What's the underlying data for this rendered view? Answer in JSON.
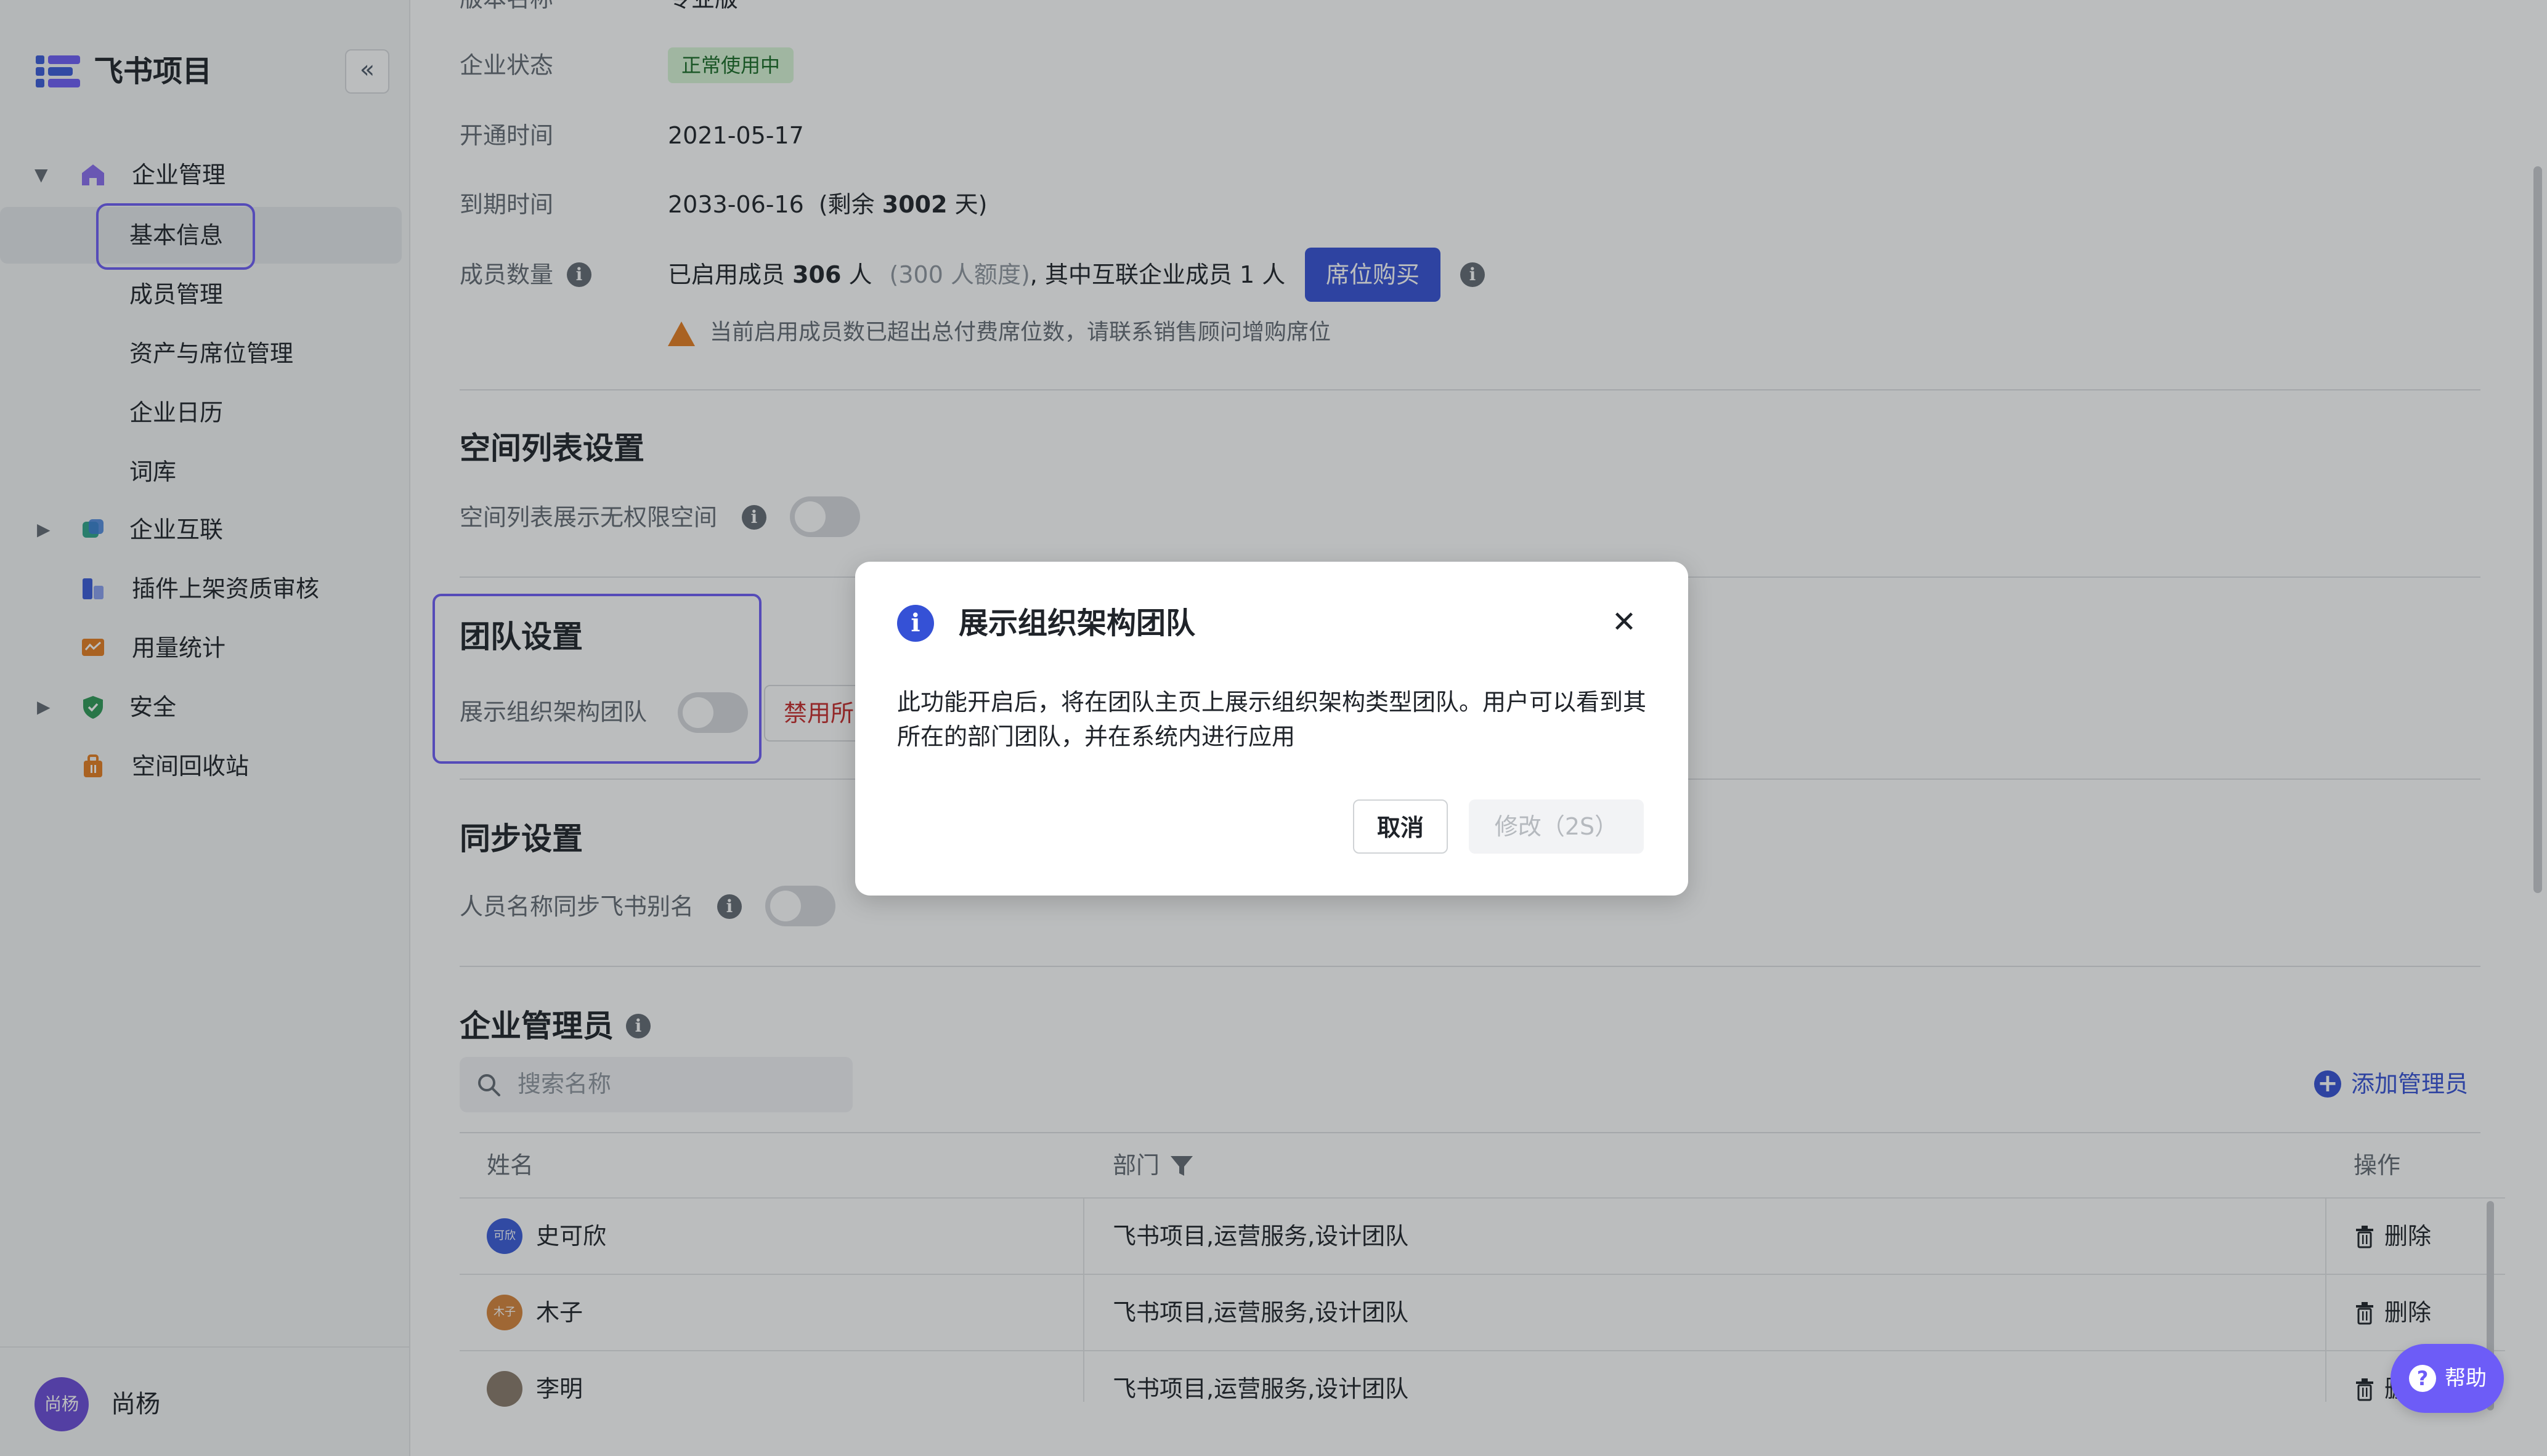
{
  "app": {
    "title": "飞书项目",
    "collapse_icon": "«"
  },
  "sidebar": {
    "items": [
      {
        "label": "企业管理",
        "icon": "home-icon",
        "expanded": true
      },
      {
        "label": "基本信息",
        "active": true
      },
      {
        "label": "成员管理"
      },
      {
        "label": "资产与席位管理"
      },
      {
        "label": "企业日历"
      },
      {
        "label": "词库"
      },
      {
        "label": "企业互联",
        "icon": "connect-icon"
      },
      {
        "label": "插件上架资质审核",
        "icon": "plugin-icon"
      },
      {
        "label": "用量统计",
        "icon": "stats-icon"
      },
      {
        "label": "安全",
        "icon": "shield-icon"
      },
      {
        "label": "空间回收站",
        "icon": "trash-bag-icon"
      }
    ],
    "user": {
      "avatar_text": "尚杨",
      "name": "尚杨"
    }
  },
  "basic_info": {
    "version_label": "版本名称",
    "version_value": "专业版",
    "status_label": "企业状态",
    "status_value": "正常使用中",
    "open_label": "开通时间",
    "open_value": "2021-05-17",
    "expire_label": "到期时间",
    "expire_value": "2033-06-16",
    "expire_remaining_prefix": "(剩余 ",
    "expire_remaining_days": "3002",
    "expire_remaining_suffix": " 天)",
    "members_label": "成员数量",
    "members_prefix": "已启用成员 ",
    "members_count": "306",
    "members_unit": " 人",
    "members_quota": "(300 人额度)",
    "members_suffix": ", 其中互联企业成员 1 人",
    "buy_seats_button": "席位购买",
    "warning_text": "当前启用成员数已超出总付费席位数，请联系销售顾问增购席位"
  },
  "space_list": {
    "title": "空间列表设置",
    "toggle_label": "空间列表展示无权限空间",
    "toggle_on": false
  },
  "team": {
    "title": "团队设置",
    "toggle_label": "展示组织架构团队",
    "toggle_on": false,
    "disable_button": "禁用所"
  },
  "sync": {
    "title": "同步设置",
    "toggle_label": "人员名称同步飞书别名",
    "toggle_on": false
  },
  "admins": {
    "title": "企业管理员",
    "search_placeholder": "搜索名称",
    "add_button": "添加管理员",
    "columns": {
      "name": "姓名",
      "dept": "部门",
      "action": "操作"
    },
    "rows": [
      {
        "avatar": "可欣",
        "avatar_color": "#3a5bd9",
        "name": "史可欣",
        "dept": "飞书项目,运营服务,设计团队",
        "action": "删除"
      },
      {
        "avatar": "木子",
        "avatar_color": "#d7843a",
        "name": "木子",
        "dept": "飞书项目,运营服务,设计团队",
        "action": "删除"
      },
      {
        "avatar": "",
        "avatar_color": "#8a7a6a",
        "name": "李明",
        "dept": "飞书项目,运营服务,设计团队",
        "action": "删除"
      }
    ]
  },
  "modal": {
    "title": "展示组织架构团队",
    "close_icon": "✕",
    "body": "此功能开启后，将在团队主页上展示组织架构类型团队。用户可以看到其所在的部门团队，并在系统内进行应用",
    "cancel": "取消",
    "confirm": "修改（2S）"
  },
  "help": {
    "label": "帮助"
  },
  "colors": {
    "accent": "#3551d6",
    "focus": "#6d5cf7",
    "warning": "#e57d20",
    "danger": "#c72a2a",
    "success_bg": "#d9f5d6"
  }
}
